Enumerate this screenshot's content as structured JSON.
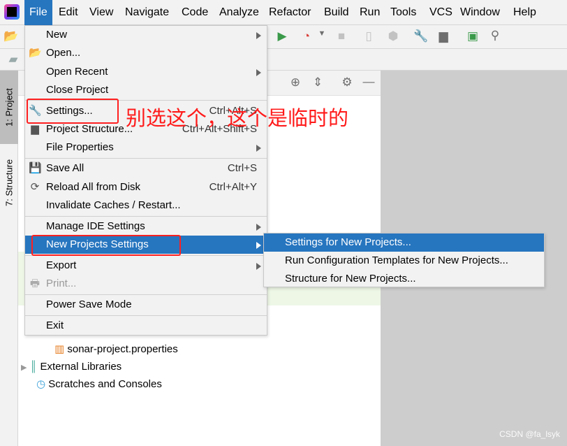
{
  "menubar": [
    "File",
    "Edit",
    "View",
    "Navigate",
    "Code",
    "Analyze",
    "Refactor",
    "Build",
    "Run",
    "Tools",
    "VCS",
    "Window",
    "Help"
  ],
  "side_tabs": {
    "project": "1: Project",
    "structure": "7: Structure"
  },
  "file_menu": {
    "new": "New",
    "open": "Open...",
    "open_recent": "Open Recent",
    "close_project": "Close Project",
    "settings": "Settings...",
    "settings_sc": "Ctrl+Alt+S",
    "project_structure": "Project Structure...",
    "project_structure_sc": "Ctrl+Alt+Shift+S",
    "file_properties": "File Properties",
    "save_all": "Save All",
    "save_all_sc": "Ctrl+S",
    "reload": "Reload All from Disk",
    "reload_sc": "Ctrl+Alt+Y",
    "invalidate": "Invalidate Caches / Restart...",
    "manage_ide": "Manage IDE Settings",
    "new_projects_settings": "New Projects Settings",
    "export": "Export",
    "print": "Print...",
    "power_save": "Power Save Mode",
    "exit": "Exit"
  },
  "submenu": [
    "Settings for New Projects...",
    "Run Configuration Templates for New Projects...",
    "Structure for New Projects..."
  ],
  "tree": {
    "file": "sonar-project.properties",
    "ext_libs": "External Libraries",
    "scratches": "Scratches and Consoles"
  },
  "annotation": "别选这个，这个是临时的",
  "watermark": "CSDN @fa_lsyk",
  "colors": {
    "highlight": "#2675bf",
    "annotation": "#ff1a1a"
  }
}
